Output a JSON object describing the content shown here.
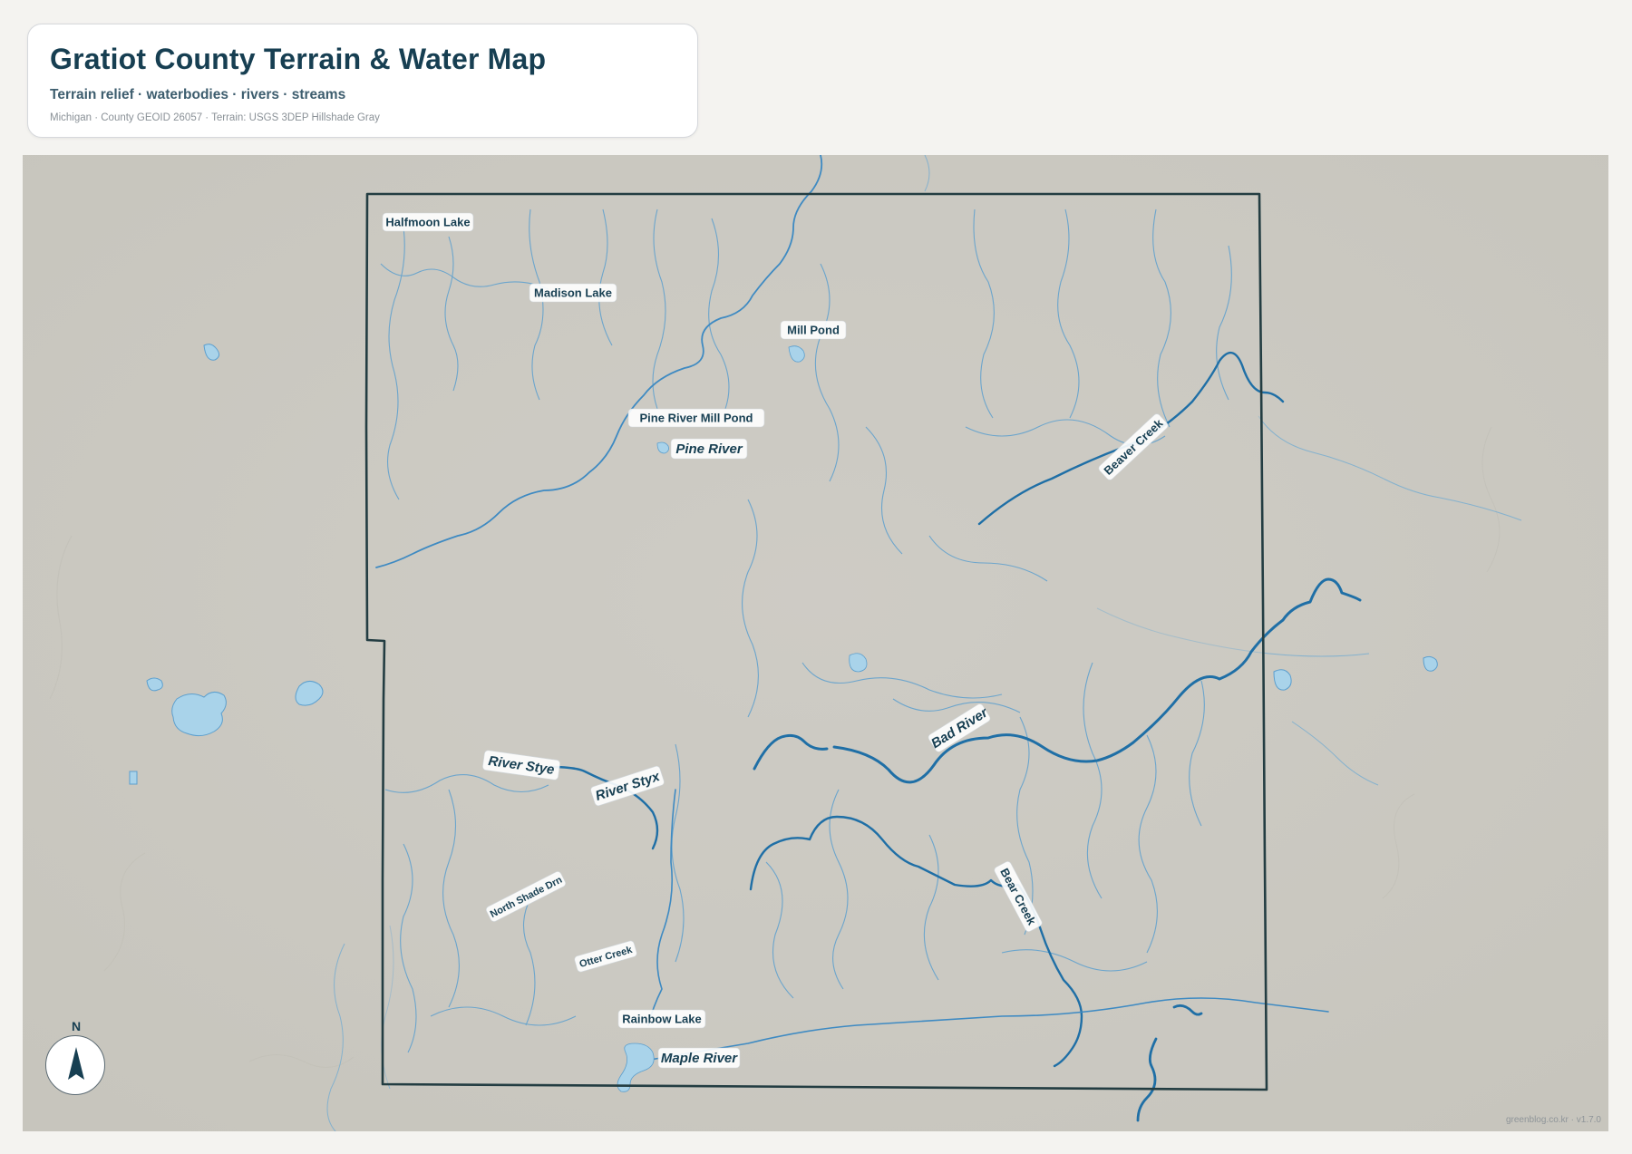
{
  "header": {
    "title": "Gratiot County Terrain & Water Map",
    "subtitle": "Terrain relief · waterbodies · rivers · streams",
    "meta": "Michigan · County GEOID 26057 · Terrain: USGS 3DEP Hillshade Gray"
  },
  "colors": {
    "terrain": "#cdcbc4",
    "boundary": "#233d42",
    "river": "#1f6fa6",
    "stream": "#5c9fce",
    "water": "#a9d3ea",
    "label_text": "#173f52"
  },
  "labels": {
    "waterbodies": [
      "Halfmoon Lake",
      "Madison Lake",
      "Mill Pond",
      "Pine River Mill Pond",
      "Rainbow Lake"
    ],
    "rivers": [
      "Pine River",
      "Beaver Creek",
      "Bad River",
      "River Stye",
      "River Styx",
      "Bear Creek",
      "Maple River"
    ],
    "streams": [
      "North Shade Drn",
      "Otter Creek"
    ]
  },
  "compass": {
    "label": "N",
    "icon": "north-arrow-icon"
  },
  "credit": "greenblog.co.kr · v1.7.0"
}
